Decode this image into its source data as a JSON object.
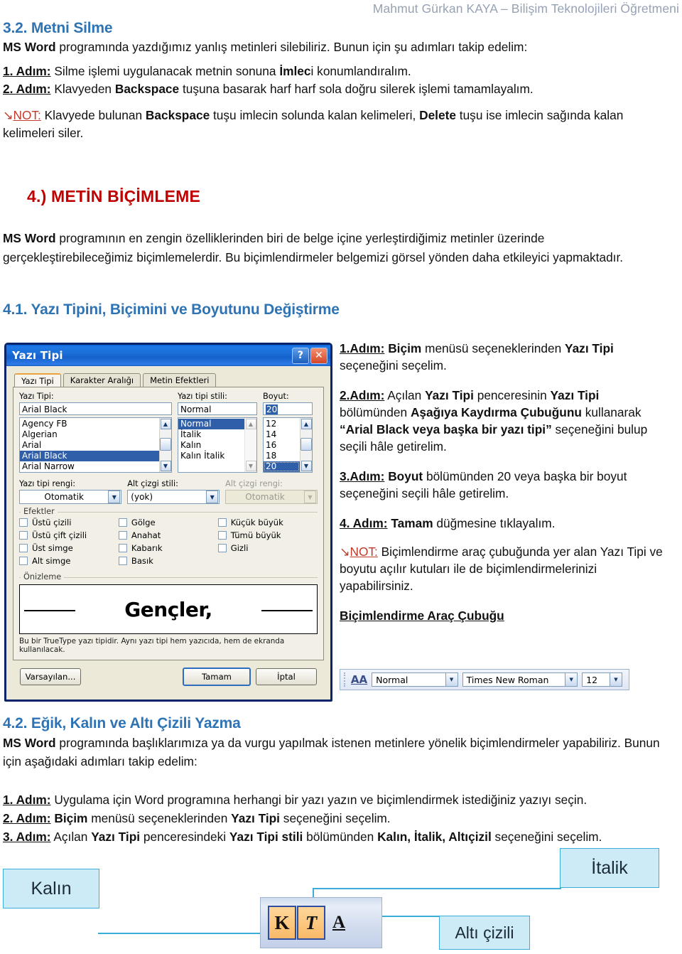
{
  "header": {
    "author_line": "Mahmut Gürkan KAYA – Bilişim Teknolojileri Öğretmeni"
  },
  "section_3_2": {
    "heading": "3.2. Metni Silme",
    "intro_bold": "MS Word",
    "intro_rest": " programında yazdığımız yanlış metinleri silebiliriz. Bunun için şu adımları takip edelim:",
    "steps": [
      {
        "label": "1. Adım:",
        "text_before": " Silme işlemi uygulanacak metnin sonuna ",
        "bold": "İmlec",
        "text_after": "i konumlandıralım."
      },
      {
        "label": "2. Adım:",
        "text_before": " Klavyeden ",
        "bold": "Backspace",
        "text_after": " tuşuna basarak harf harf sola doğru silerek işlemi tamamlayalım."
      }
    ],
    "note": {
      "arrow": "↘",
      "tag": "NOT:",
      "p1": " Klavyede bulunan ",
      "b1": "Backspace",
      "p2": " tuşu imlecin solunda kalan kelimeleri, ",
      "b2": "Delete",
      "p3": " tuşu ise imlecin sağında kalan kelimeleri siler."
    }
  },
  "section_4": {
    "heading": "4.) METİN BİÇİMLEME",
    "para_bold": "MS Word",
    "para_rest": " programının en zengin özelliklerinden biri de belge içine yerleştirdiğimiz metinler üzerinde gerçekleştirebileceğimiz biçimlemelerdir. Bu biçimlendirmeler belgemizi görsel yönden daha etkileyici yapmaktadır."
  },
  "section_4_1": {
    "heading": "4.1. Yazı Tipini, Biçimini ve Boyutunu Değiştirme",
    "steps": [
      {
        "label": "1.Adım:",
        "parts": [
          {
            "t": " ",
            "b": false
          },
          {
            "t": "Biçim",
            "b": true
          },
          {
            "t": " menüsü seçeneklerinden ",
            "b": false
          },
          {
            "t": "Yazı Tipi",
            "b": true
          },
          {
            "t": " seçeneğini seçelim.",
            "b": false
          }
        ]
      },
      {
        "label": "2.Adım:",
        "parts": [
          {
            "t": " Açılan ",
            "b": false
          },
          {
            "t": "Yazı Tipi",
            "b": true
          },
          {
            "t": " penceresinin ",
            "b": false
          },
          {
            "t": "Yazı Tipi",
            "b": true
          },
          {
            "t": " bölümünden ",
            "b": false
          },
          {
            "t": "Aşağıya Kaydırma Çubuğunu",
            "b": true
          },
          {
            "t": " kullanarak ",
            "b": false
          },
          {
            "t": "“Arial Black veya başka bir yazı tipi”",
            "b": true
          },
          {
            "t": " seçeneğini bulup seçili hâle getirelim.",
            "b": false
          }
        ]
      },
      {
        "label": "3.Adım:",
        "parts": [
          {
            "t": "  ",
            "b": false
          },
          {
            "t": "Boyut",
            "b": true
          },
          {
            "t": " bölümünden 20 veya başka bir boyut seçeneğini seçili hâle getirelim.",
            "b": false
          }
        ]
      },
      {
        "label": "4. Adım:",
        "parts": [
          {
            "t": "  ",
            "b": false
          },
          {
            "t": "Tamam",
            "b": true
          },
          {
            "t": " düğmesine tıklayalım.",
            "b": false
          }
        ]
      }
    ],
    "note": {
      "arrow": "↘",
      "tag": "NOT:",
      "text": " Biçimlendirme araç çubuğunda yer alan Yazı Tipi ve boyutu açılır kutuları ile de biçimlendirmelerinizi yapabilirsiniz."
    },
    "toolbar_caption": "Biçimlendirme Araç Çubuğu"
  },
  "font_dialog": {
    "title": "Yazı Tipi",
    "help_button": "?",
    "close_button": "✕",
    "tabs": [
      {
        "label": "Yazı Tipi",
        "active": true
      },
      {
        "label": "Karakter Aralığı",
        "active": false
      },
      {
        "label": "Metin Efektleri",
        "active": false
      }
    ],
    "font_label": "Yazı Tipi:",
    "font_value": "Arial Black",
    "font_list": [
      "Agency FB",
      "Algerian",
      "Arial",
      "Arial Black",
      "Arial Narrow"
    ],
    "font_selected": "Arial Black",
    "style_label": "Yazı tipi stili:",
    "style_value": "Normal",
    "style_list": [
      "Normal",
      "İtalik",
      "Kalın",
      "Kalın İtalik"
    ],
    "style_selected": "Normal",
    "size_label": "Boyut:",
    "size_value": "20",
    "size_list": [
      "12",
      "14",
      "16",
      "18",
      "20"
    ],
    "size_selected": "20",
    "font_color_label": "Yazı tipi rengi:",
    "font_color_value": "Otomatik",
    "underline_style_label": "Alt çizgi stili:",
    "underline_style_value": "(yok)",
    "underline_color_label": "Alt çizgi rengi:",
    "underline_color_value": "Otomatik",
    "effects_group": "Efektler",
    "effects_col1": [
      "Üstü çizili",
      "Üstü çift çizili",
      "Üst simge",
      "Alt simge"
    ],
    "effects_col2": [
      "Gölge",
      "Anahat",
      "Kabarık",
      "Basık"
    ],
    "effects_col3": [
      "Küçük büyük",
      "Tümü büyük",
      "Gizli"
    ],
    "preview_group": "Önizleme",
    "preview_text": "Gençler,",
    "preview_note": "Bu bir TrueType yazı tipidir. Aynı yazı tipi hem yazıcıda, hem de ekranda kullanılacak.",
    "btn_default": "Varsayılan...",
    "btn_ok": "Tamam",
    "btn_cancel": "İptal"
  },
  "formatting_toolbar": {
    "icon": "AA",
    "style_value": "Normal",
    "font_value": "Times New Roman",
    "size_value": "12"
  },
  "section_4_2": {
    "heading": "4.2. Eğik, Kalın ve Altı Çizili Yazma",
    "para_bold": "MS Word",
    "para_rest": " programında başlıklarımıza ya da vurgu yapılmak istenen metinlere yönelik biçimlendirmeler yapabiliriz. Bunun için aşağıdaki adımları takip edelim:",
    "steps": [
      {
        "label": "1. Adım:",
        "parts": [
          {
            "t": " Uygulama için Word programına herhangi bir yazı yazın ve biçimlendirmek istediğiniz yazıyı seçin.",
            "b": false
          }
        ]
      },
      {
        "label": "2. Adım:",
        "parts": [
          {
            "t": " ",
            "b": false
          },
          {
            "t": "Biçim",
            "b": true
          },
          {
            "t": " menüsü seçeneklerinden ",
            "b": false
          },
          {
            "t": "Yazı Tipi",
            "b": true
          },
          {
            "t": " seçeneğini seçelim.",
            "b": false
          }
        ]
      },
      {
        "label": "3. Adım:",
        "parts": [
          {
            "t": " Açılan ",
            "b": false
          },
          {
            "t": "Yazı Tipi",
            "b": true
          },
          {
            "t": " penceresindeki ",
            "b": false
          },
          {
            "t": "Yazı Tipi stili",
            "b": true
          },
          {
            "t": " bölümünden ",
            "b": false
          },
          {
            "t": "Kalın, İtalik, Altıçizil",
            "b": true
          },
          {
            "t": " seçeneğini seçelim.",
            "b": false
          }
        ]
      }
    ]
  },
  "callouts": {
    "bold": "Kalın",
    "italic": "İtalik",
    "underline": "Altı çizili",
    "toolbar_buttons": {
      "bold": "K",
      "italic": "T",
      "underline": "A"
    }
  },
  "colors": {
    "heading_blue": "#2e74b5",
    "heading_red": "#c00000",
    "note_red": "#c0392b",
    "header_gray": "#96a2b4",
    "callout_fill": "#cdebf7",
    "callout_border": "#3aadd9"
  }
}
